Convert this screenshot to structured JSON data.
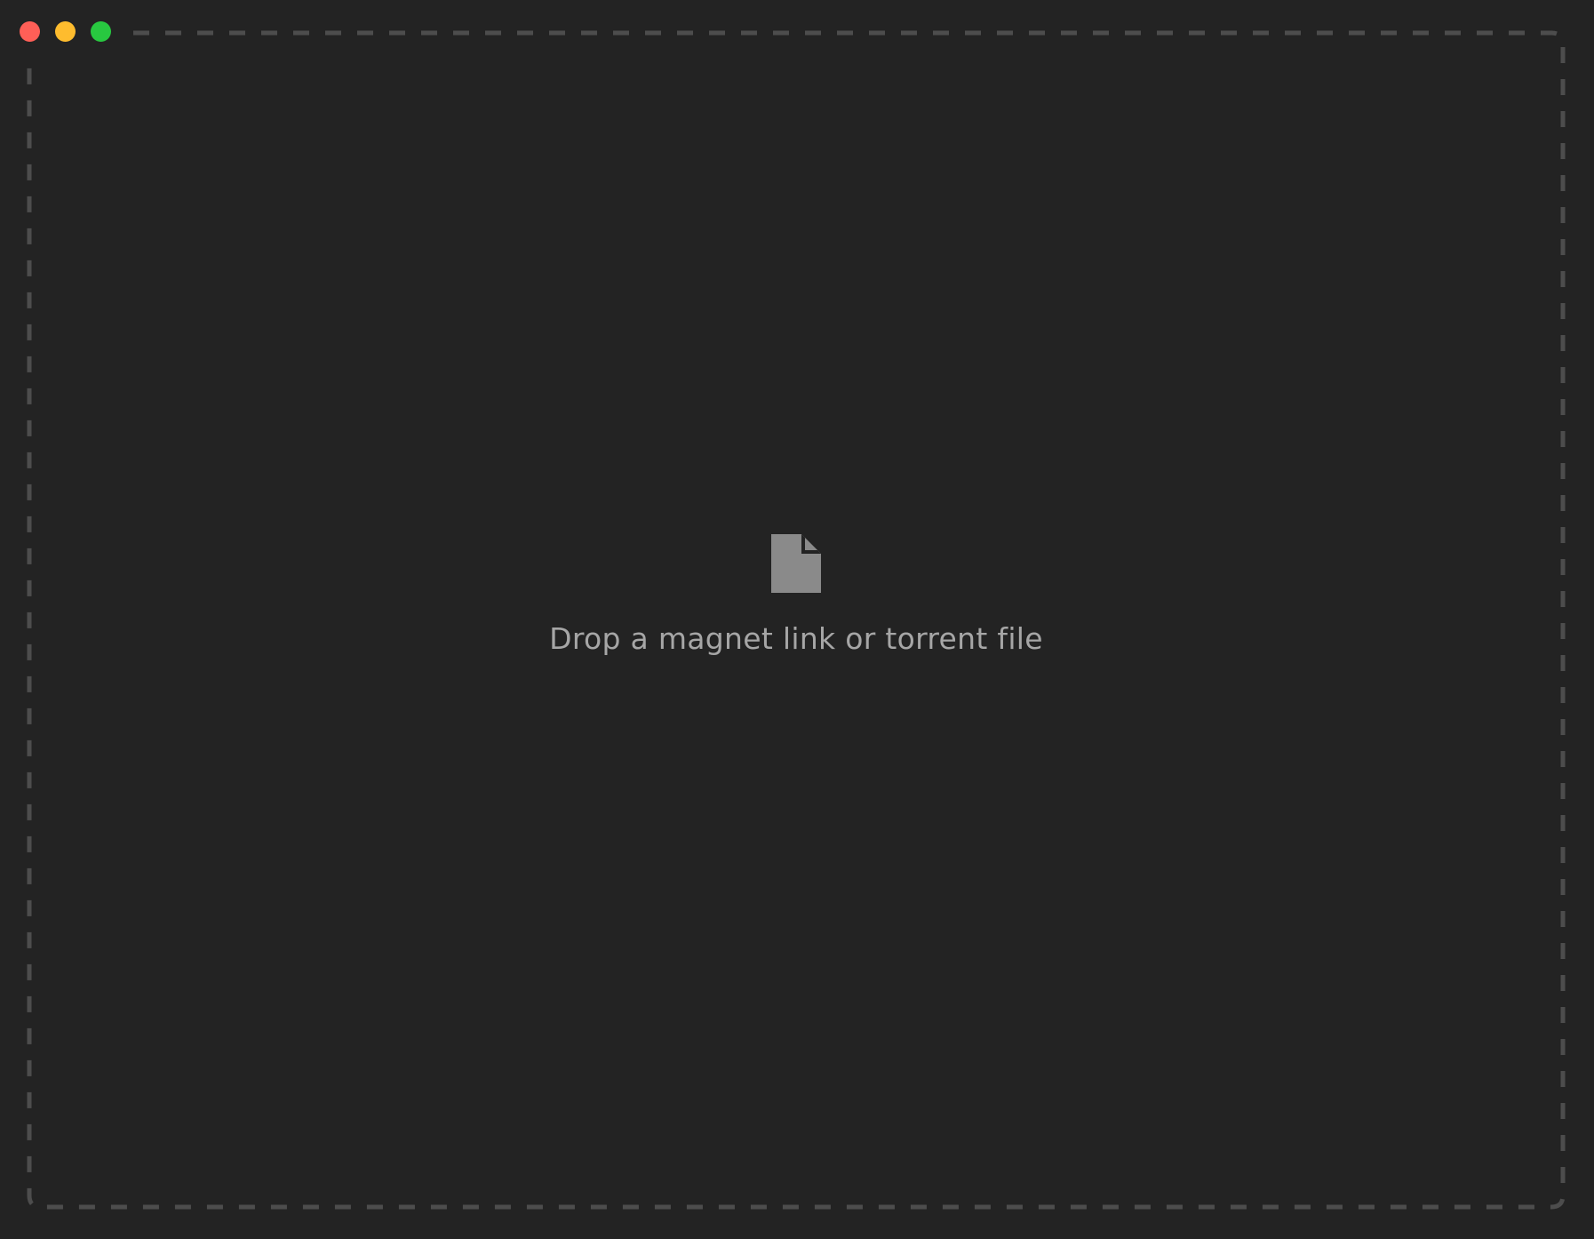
{
  "window": {
    "controls": [
      {
        "name": "close",
        "color": "#ff5f57"
      },
      {
        "name": "minimize",
        "color": "#febc2e"
      },
      {
        "name": "zoom",
        "color": "#28c840"
      }
    ]
  },
  "dropzone": {
    "icon": "file-icon",
    "label": "Drop a magnet link or torrent file",
    "border_color": "#4d4d4d",
    "background": "#232323",
    "text_color": "#a6a6a6",
    "icon_color": "#8a8a8a"
  }
}
